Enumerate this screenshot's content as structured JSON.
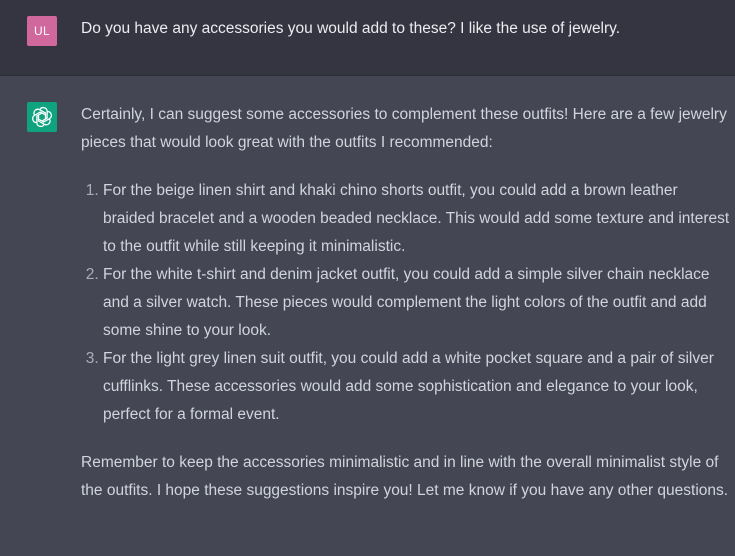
{
  "user_message": {
    "avatar_initials": "UL",
    "text": "Do you have any accessories you would add to these? I like the use of jewelry."
  },
  "assistant_message": {
    "avatar_icon": "openai-logo-icon",
    "intro": "Certainly, I can suggest some accessories to complement these outfits! Here are a few jewelry pieces that would look great with the outfits I recommended:",
    "items": [
      "For the beige linen shirt and khaki chino shorts outfit, you could add a brown leather braided bracelet and a wooden beaded necklace. This would add some texture and interest to the outfit while still keeping it minimalistic.",
      "For the white t-shirt and denim jacket outfit, you could add a simple silver chain necklace and a silver watch. These pieces would complement the light colors of the outfit and add some shine to your look.",
      "For the light grey linen suit outfit, you could add a white pocket square and a pair of silver cufflinks. These accessories would add some sophistication and elegance to your look, perfect for a formal event."
    ],
    "outro": "Remember to keep the accessories minimalistic and in line with the overall minimalist style of the outfits. I hope these suggestions inspire you! Let me know if you have any other questions."
  },
  "colors": {
    "user_bg": "#343541",
    "assistant_bg": "#444654",
    "user_avatar": "#d0679d",
    "bot_avatar": "#10a37f",
    "text": "#d1d5db"
  }
}
